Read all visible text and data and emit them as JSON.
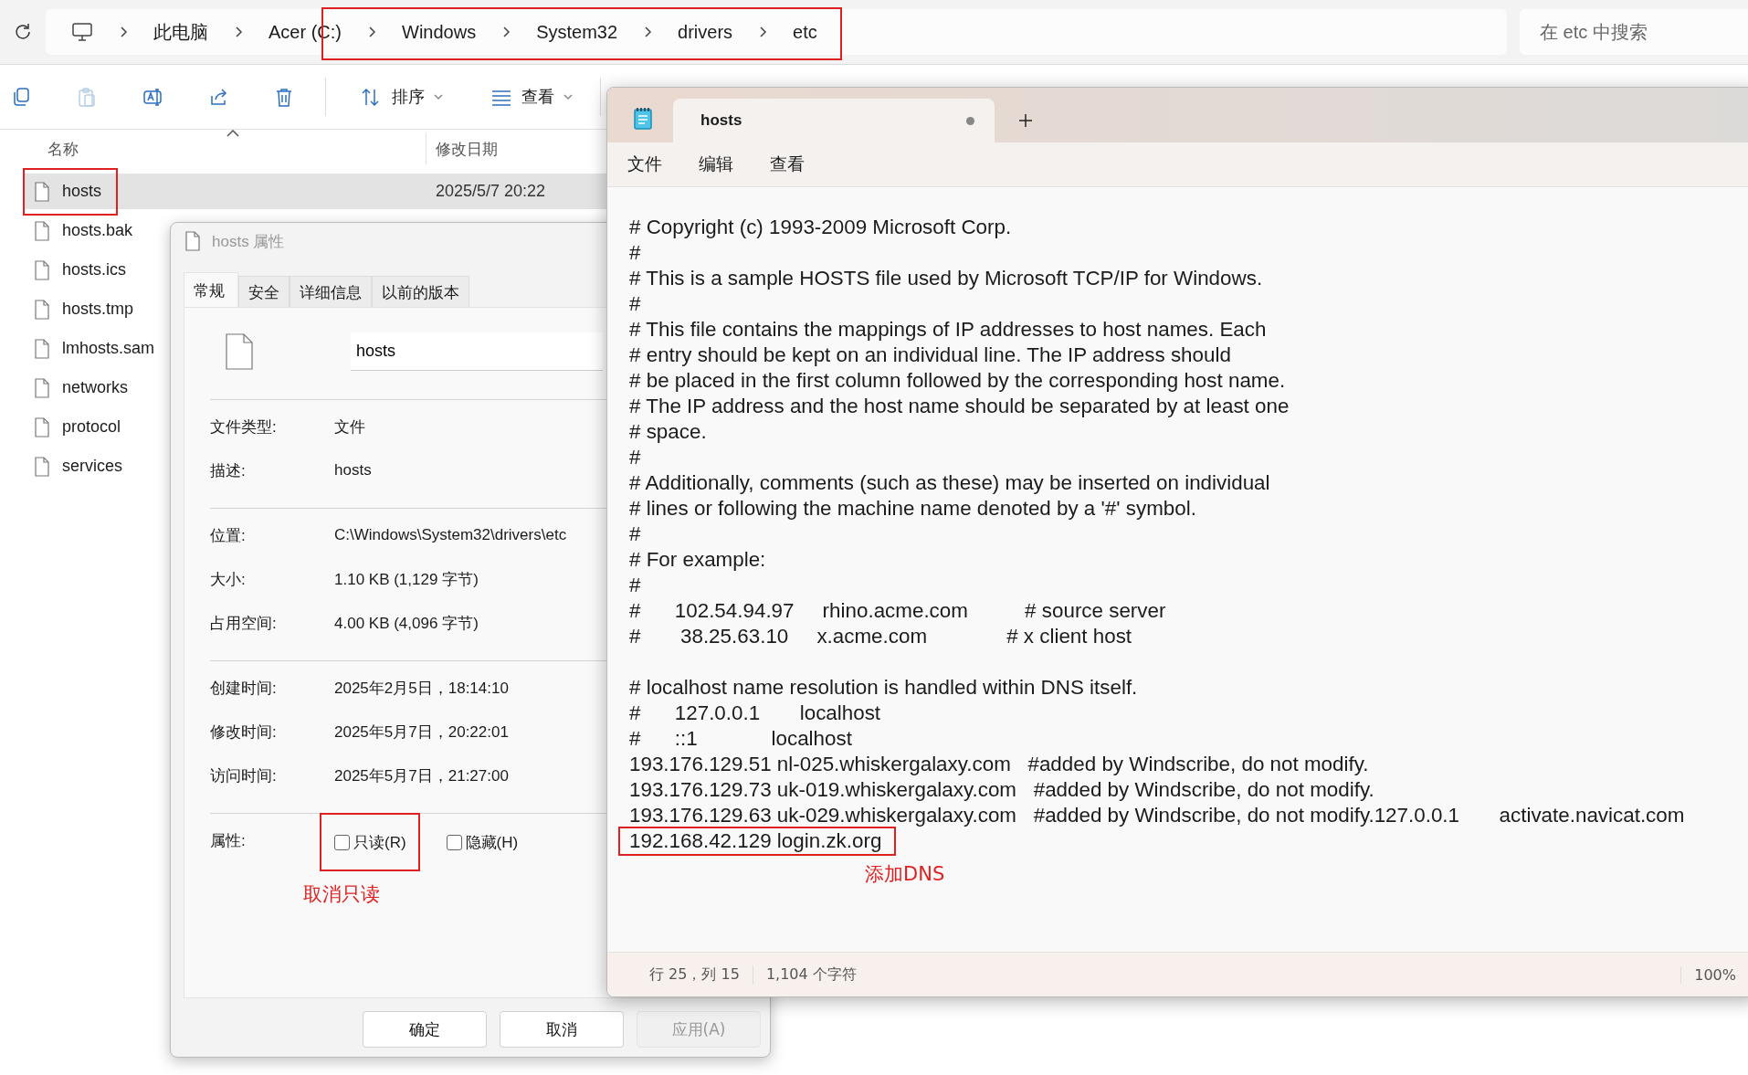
{
  "explorer": {
    "breadcrumbs": [
      "此电脑",
      "Acer (C:)",
      "Windows",
      "System32",
      "drivers",
      "etc"
    ],
    "search": {
      "placeholder": "在 etc 中搜索"
    },
    "toolbar": [
      {
        "kind": "copy"
      },
      {
        "kind": "paste",
        "disabled": true
      },
      {
        "kind": "rename"
      },
      {
        "kind": "share"
      },
      {
        "kind": "delete"
      },
      {
        "kind": "sort",
        "label": "排序"
      },
      {
        "kind": "view",
        "label": "查看"
      }
    ],
    "columns": [
      {
        "label": "名称",
        "sorted": true
      },
      {
        "label": "修改日期"
      }
    ],
    "files": [
      {
        "name": "hosts",
        "modified": "2025/5/7 20:22",
        "selected": true
      },
      {
        "name": "hosts.bak",
        "selected": false
      },
      {
        "name": "hosts.ics",
        "selected": false
      },
      {
        "name": "hosts.tmp",
        "selected": false
      },
      {
        "name": "lmhosts.sam",
        "selected": false
      },
      {
        "name": "networks",
        "selected": false
      },
      {
        "name": "protocol",
        "selected": false
      },
      {
        "name": "services",
        "selected": false
      }
    ]
  },
  "properties": {
    "title": "hosts 属性",
    "tabs": [
      {
        "label": "常规",
        "selected": true
      },
      {
        "label": "安全",
        "selected": false
      },
      {
        "label": "详细信息",
        "selected": false
      },
      {
        "label": "以前的版本",
        "selected": false
      }
    ],
    "name_value": "hosts",
    "groups": [
      [
        {
          "label": "文件类型:",
          "value": "文件"
        },
        {
          "label": "描述:",
          "value": "hosts"
        }
      ],
      [
        {
          "label": "位置:",
          "value": "C:\\Windows\\System32\\drivers\\etc"
        },
        {
          "label": "大小:",
          "value": "1.10 KB (1,129 字节)"
        },
        {
          "label": "占用空间:",
          "value": "4.00 KB (4,096 字节)"
        }
      ],
      [
        {
          "label": "创建时间:",
          "value": "2025年2月5日，18:14:10"
        },
        {
          "label": "修改时间:",
          "value": "2025年5月7日，20:22:01"
        },
        {
          "label": "访问时间:",
          "value": "2025年5月7日，21:27:00"
        }
      ]
    ],
    "attributes": {
      "label": "属性:",
      "checkboxes": [
        {
          "label": "只读(R)",
          "checked": false
        },
        {
          "label": "隐藏(H)",
          "checked": false
        }
      ],
      "note": "取消只读"
    },
    "buttons": [
      {
        "label": "确定",
        "disabled": false
      },
      {
        "label": "取消",
        "disabled": false
      },
      {
        "label": "应用(A)",
        "disabled": true
      }
    ]
  },
  "notepad": {
    "tab_title": "hosts",
    "unsaved": true,
    "menu": [
      "文件",
      "编辑",
      "查看"
    ],
    "lines": [
      {
        "kind": "text",
        "text": "# Copyright (c) 1993-2009 Microsoft Corp."
      },
      {
        "kind": "text",
        "text": "#"
      },
      {
        "kind": "text",
        "text": "# This is a sample HOSTS file used by Microsoft TCP/IP for Windows."
      },
      {
        "kind": "text",
        "text": "#"
      },
      {
        "kind": "text",
        "text": "# This file contains the mappings of IP addresses to host names. Each"
      },
      {
        "kind": "text",
        "text": "# entry should be kept on an individual line. The IP address should"
      },
      {
        "kind": "text",
        "text": "# be placed in the first column followed by the corresponding host name."
      },
      {
        "kind": "text",
        "text": "# The IP address and the host name should be separated by at least one"
      },
      {
        "kind": "text",
        "text": "# space."
      },
      {
        "kind": "text",
        "text": "#"
      },
      {
        "kind": "text",
        "text": "# Additionally, comments (such as these) may be inserted on individual"
      },
      {
        "kind": "text",
        "text": "# lines or following the machine name denoted by a '#' symbol."
      },
      {
        "kind": "text",
        "text": "#"
      },
      {
        "kind": "text",
        "text": "# For example:"
      },
      {
        "kind": "text",
        "text": "#"
      },
      {
        "kind": "text",
        "text": "#      102.54.94.97     rhino.acme.com          # source server"
      },
      {
        "kind": "text",
        "text": "#       38.25.63.10     x.acme.com              # x client host"
      },
      {
        "kind": "blank"
      },
      {
        "kind": "text",
        "text": "# localhost name resolution is handled within DNS itself."
      },
      {
        "kind": "text",
        "text": "#      127.0.0.1       localhost"
      },
      {
        "kind": "text",
        "text": "#      ::1             localhost"
      },
      {
        "kind": "text",
        "text": "193.176.129.51 nl-025.whiskergalaxy.com   #added by Windscribe, do not modify."
      },
      {
        "kind": "text",
        "text": "193.176.129.73 uk-019.whiskergalaxy.com   #added by Windscribe, do not modify."
      },
      {
        "kind": "text",
        "text": "193.176.129.63 uk-029.whiskergalaxy.com   #added by Windscribe, do not modify.127.0.0.1       activate.navicat.com"
      },
      {
        "kind": "text",
        "text": "192.168.42.129 login.zk.org"
      }
    ],
    "note": "添加DNS",
    "status": {
      "position": "行 25，列 15",
      "chars": "1,104 个字符",
      "zoom": "100%"
    }
  }
}
